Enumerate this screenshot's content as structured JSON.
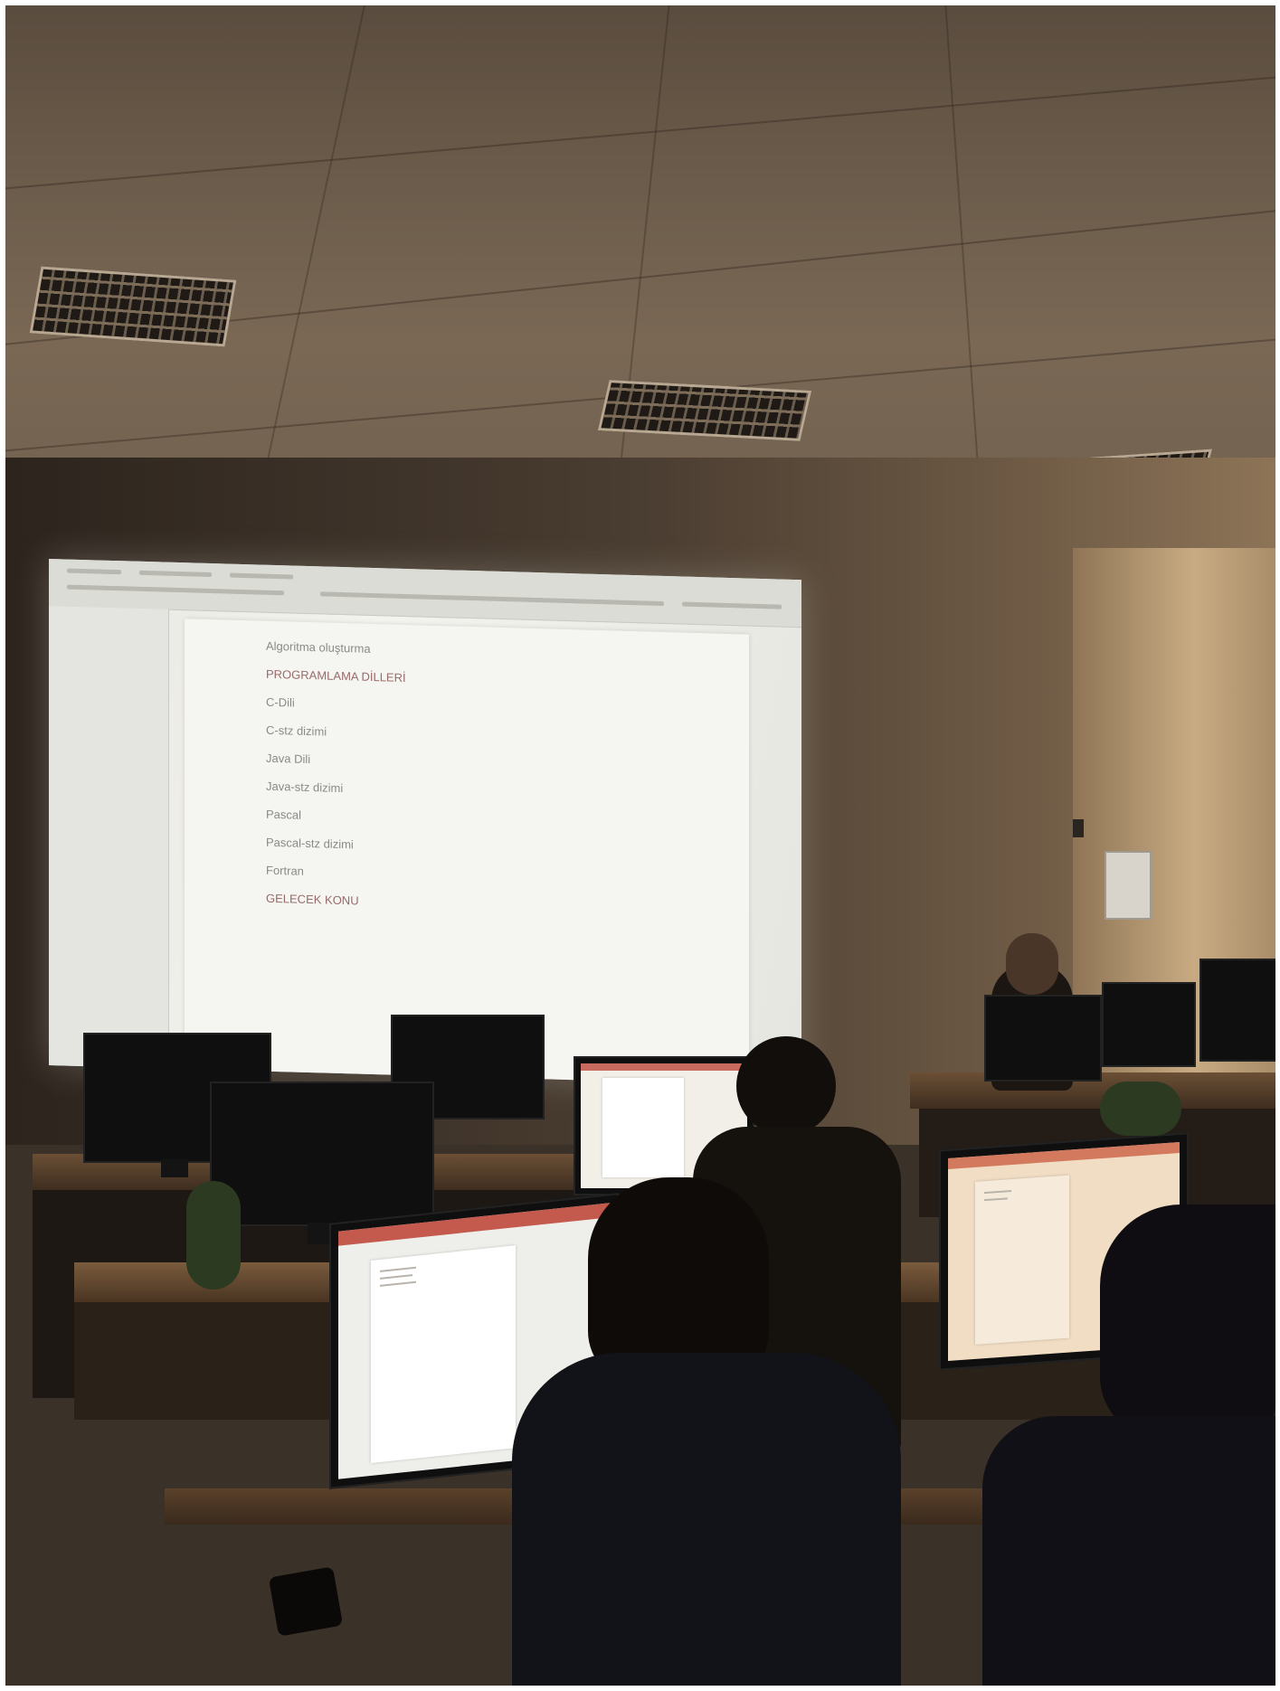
{
  "projected_document": {
    "lines": [
      "Algoritma oluşturma",
      "PROGRAMLAMA DİLLERİ",
      "C-Dili",
      "C-stz dizimi",
      "Java Dili",
      "Java-stz dizimi",
      "Pascal",
      "Pascal-stz dizimi",
      "Fortran",
      "GELECEK KONU"
    ]
  }
}
